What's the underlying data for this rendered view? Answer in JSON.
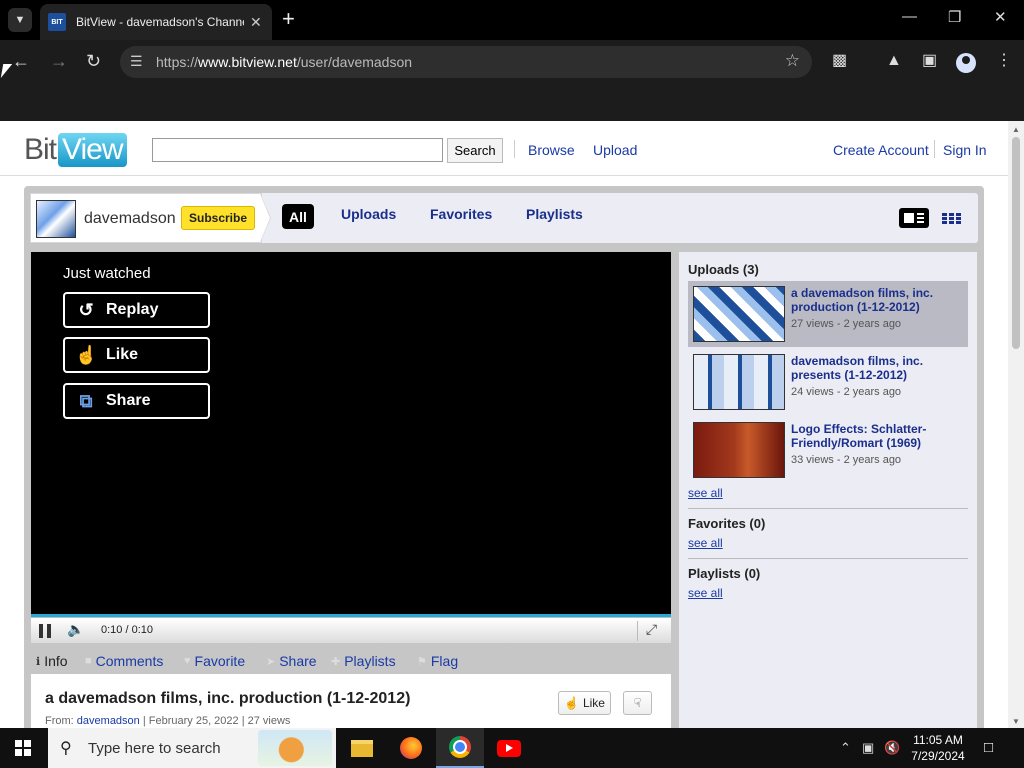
{
  "browser": {
    "tab_title": "BitView - davemadson's Channel",
    "favicon_text": "BIT VIEW",
    "url_prefix": "https://",
    "url_host": "www.bitview.net",
    "url_path": "/user/davemadson"
  },
  "site": {
    "logo_bit": "Bit",
    "logo_view": "View",
    "search_value": "",
    "search_button": "Search",
    "nav": {
      "browse": "Browse",
      "upload": "Upload",
      "create_account": "Create Account",
      "sign_in": "Sign In"
    }
  },
  "channel": {
    "name": "davemadson",
    "subscribe_label": "Subscribe",
    "tabs": {
      "all": "All",
      "uploads": "Uploads",
      "favorites": "Favorites",
      "playlists": "Playlists"
    }
  },
  "player": {
    "overlay_title": "Just watched",
    "replay_label": "Replay",
    "like_label": "Like",
    "share_label": "Share",
    "time": "0:10 / 0:10",
    "progress_fraction": 1.0
  },
  "info_tabs": {
    "info": "Info",
    "comments": "Comments",
    "favorite": "Favorite",
    "share": "Share",
    "playlists": "Playlists",
    "flag": "Flag"
  },
  "video": {
    "title": "a davemadson films, inc. production (1-12-2012)",
    "from_label": "From:",
    "from_user": "davemadson",
    "meta_rest": " | February 25, 2022 | 27 views",
    "like_label": "Like"
  },
  "sidebar": {
    "uploads_heading": "Uploads (3)",
    "uploads": [
      {
        "title": "a davemadson films, inc. production (1-12-2012)",
        "meta": "27 views - 2 years ago"
      },
      {
        "title": "davemadson films, inc. presents (1-12-2012)",
        "meta": "24 views - 2 years ago"
      },
      {
        "title": "Logo Effects: Schlatter-Friendly/Romart (1969)",
        "meta": "33 views - 2 years ago"
      }
    ],
    "see_all": "see all",
    "favorites_heading": "Favorites (0)",
    "playlists_heading": "Playlists (0)"
  },
  "taskbar": {
    "search_placeholder": "Type here to search",
    "time": "11:05 AM",
    "date": "7/29/2024",
    "notification_count": "1"
  }
}
